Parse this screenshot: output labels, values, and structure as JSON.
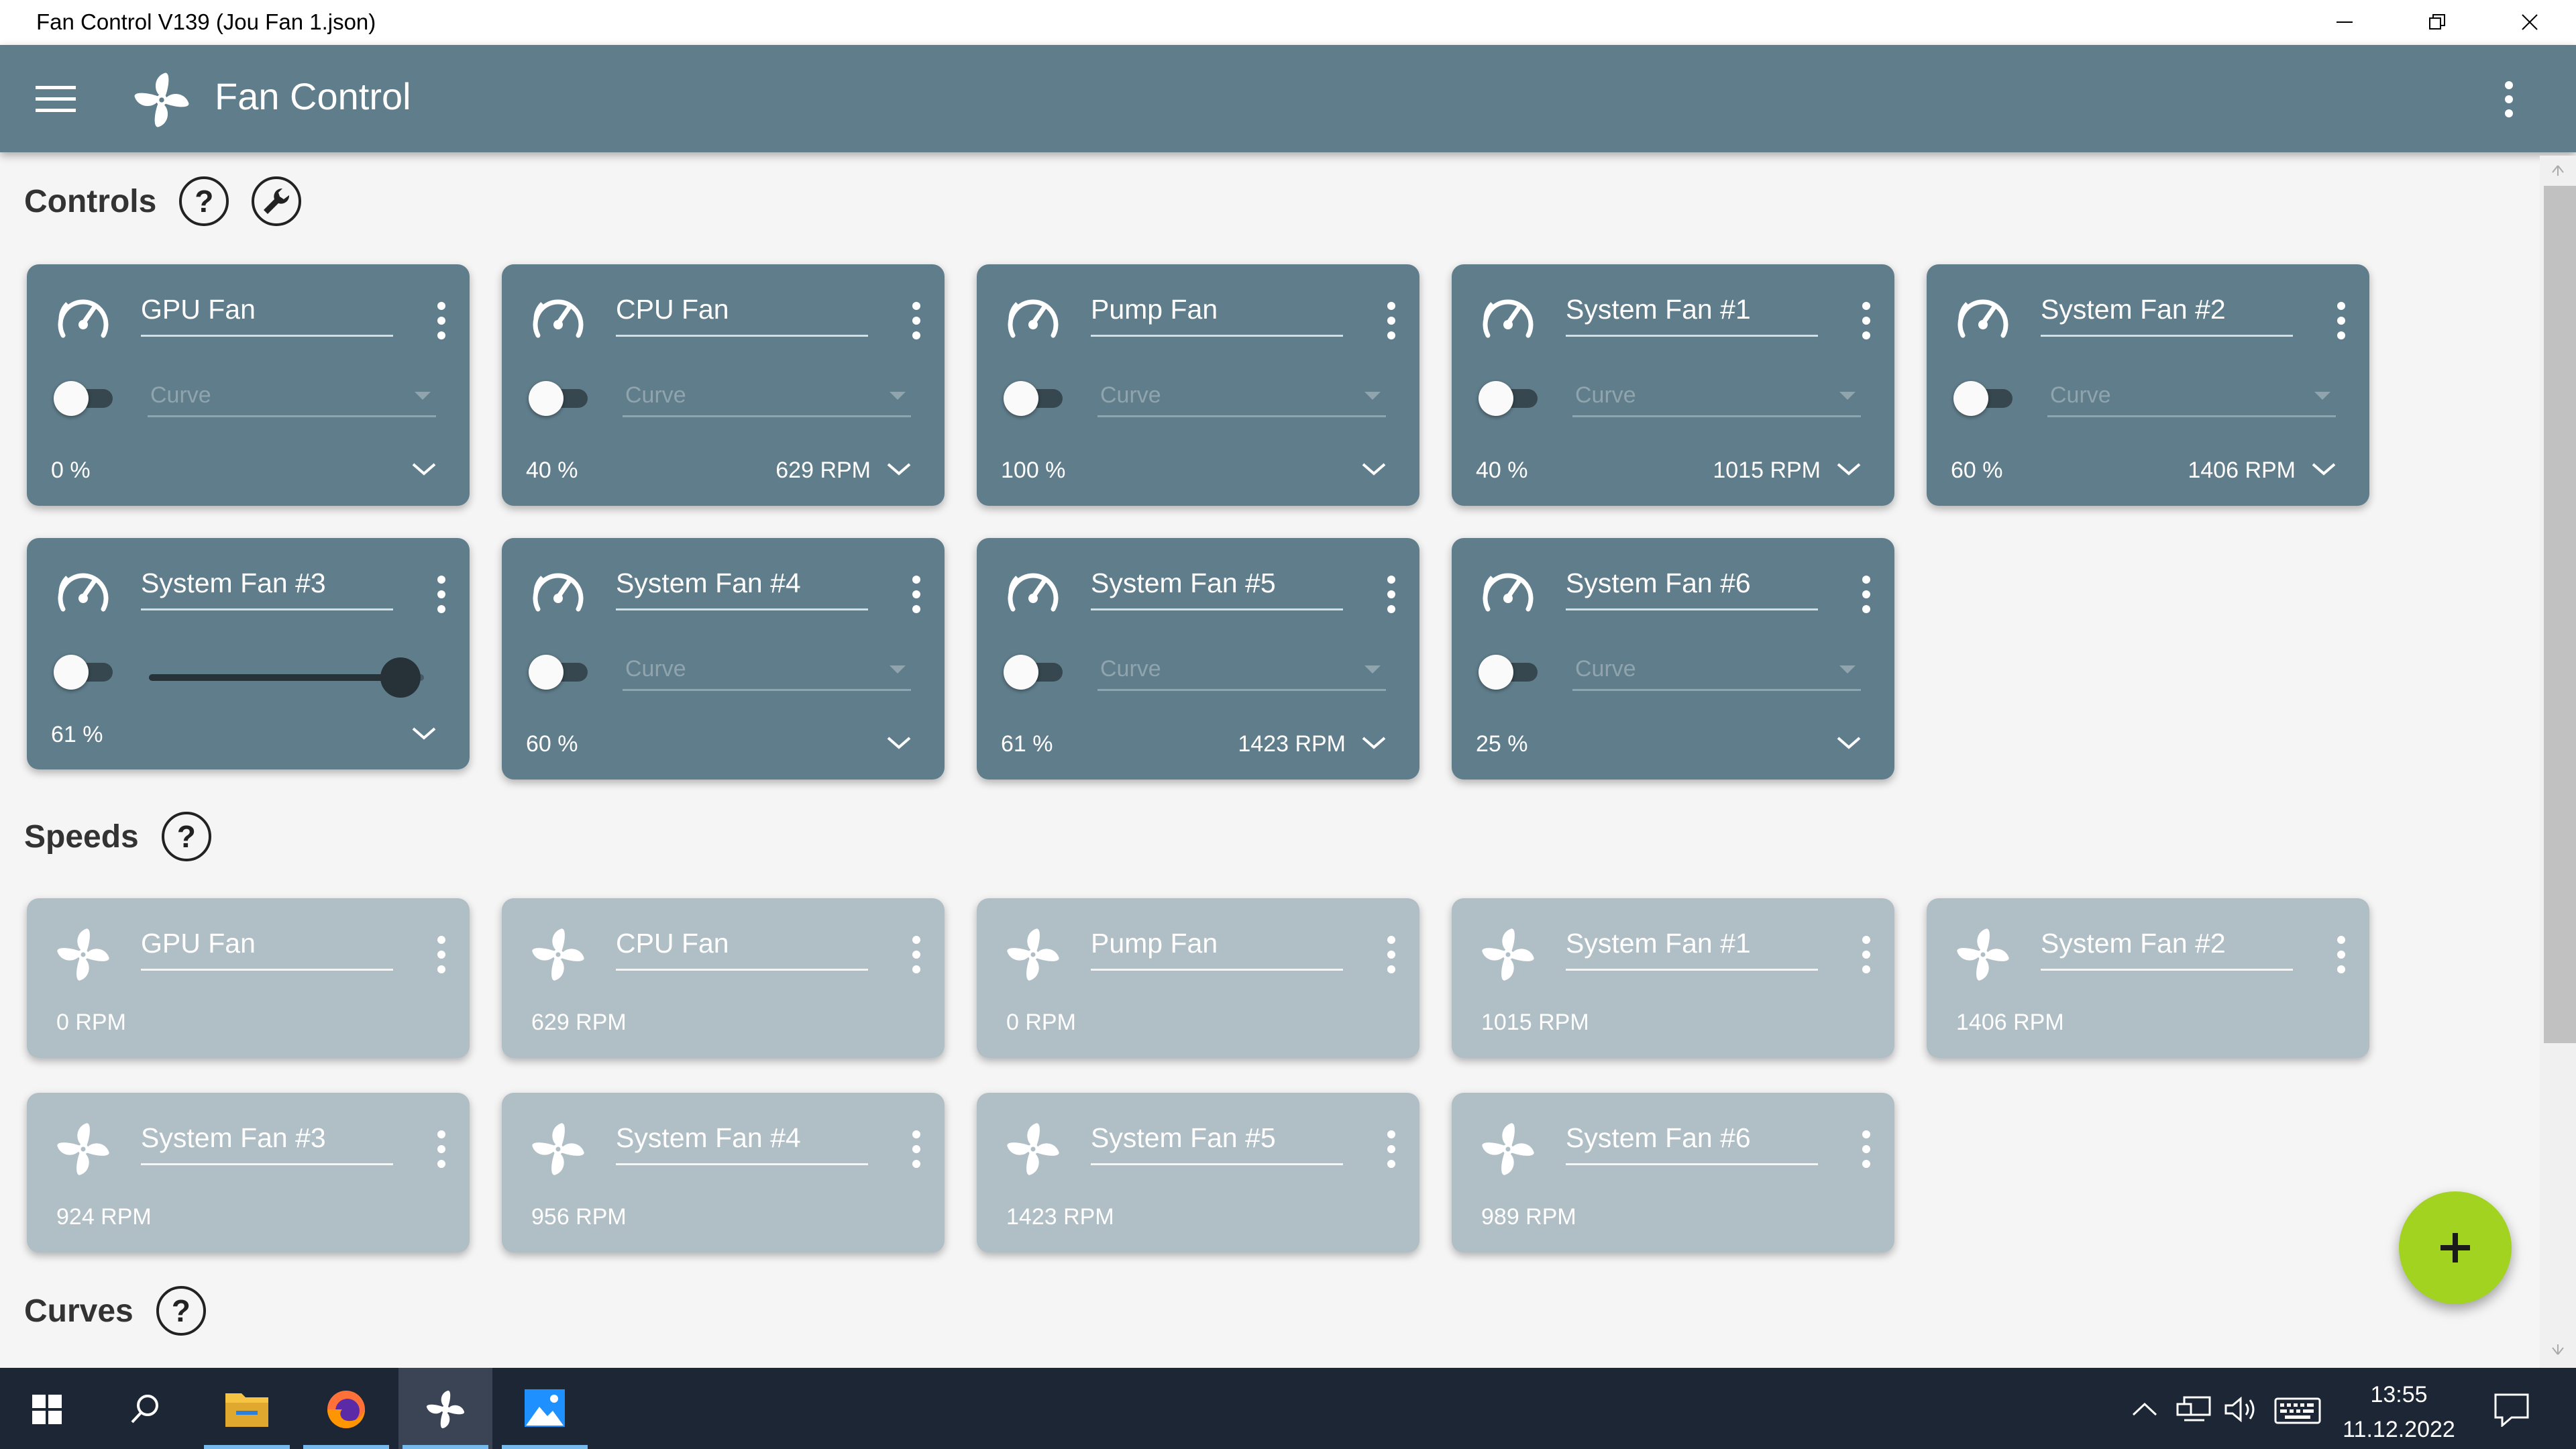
{
  "window": {
    "title": "Fan Control V139 (Jou Fan 1.json)",
    "controls": [
      "minimize-icon",
      "restore-icon",
      "close-icon"
    ]
  },
  "appbar": {
    "title": "Fan Control",
    "menu_icon": "hamburger-menu-icon",
    "logo_icon": "fan-icon",
    "more_icon": "more-vert-icon"
  },
  "sections": {
    "controls": {
      "title": "Controls",
      "help": "?",
      "tool_icon": "wrench-icon"
    },
    "speeds": {
      "title": "Speeds",
      "help": "?"
    },
    "curves": {
      "title": "Curves",
      "help": "?"
    }
  },
  "controls": [
    {
      "name": "GPU Fan",
      "mode": "Curve",
      "enabled": false,
      "percent": "0 %",
      "rpm": ""
    },
    {
      "name": "CPU Fan",
      "mode": "Curve",
      "enabled": false,
      "percent": "40 %",
      "rpm": "629 RPM"
    },
    {
      "name": "Pump Fan",
      "mode": "Curve",
      "enabled": false,
      "percent": "100 %",
      "rpm": ""
    },
    {
      "name": "System Fan #1",
      "mode": "Curve",
      "enabled": false,
      "percent": "40 %",
      "rpm": "1015 RPM"
    },
    {
      "name": "System Fan #2",
      "mode": "Curve",
      "enabled": false,
      "percent": "60 %",
      "rpm": "1406 RPM"
    },
    {
      "name": "System Fan #3",
      "mode": "slider",
      "enabled": false,
      "percent": "61 %",
      "rpm": "",
      "slider_value": 0.61
    },
    {
      "name": "System Fan #4",
      "mode": "Curve",
      "enabled": false,
      "percent": "60 %",
      "rpm": ""
    },
    {
      "name": "System Fan #5",
      "mode": "Curve",
      "enabled": false,
      "percent": "61 %",
      "rpm": "1423 RPM"
    },
    {
      "name": "System Fan #6",
      "mode": "Curve",
      "enabled": false,
      "percent": "25 %",
      "rpm": ""
    }
  ],
  "speeds": [
    {
      "name": "GPU Fan",
      "rpm": "0 RPM"
    },
    {
      "name": "CPU Fan",
      "rpm": "629 RPM"
    },
    {
      "name": "Pump Fan",
      "rpm": "0 RPM"
    },
    {
      "name": "System Fan #1",
      "rpm": "1015 RPM"
    },
    {
      "name": "System Fan #2",
      "rpm": "1406 RPM"
    },
    {
      "name": "System Fan #3",
      "rpm": "924 RPM"
    },
    {
      "name": "System Fan #4",
      "rpm": "956 RPM"
    },
    {
      "name": "System Fan #5",
      "rpm": "1423 RPM"
    },
    {
      "name": "System Fan #6",
      "rpm": "989 RPM"
    }
  ],
  "fab": {
    "icon": "plus-icon"
  },
  "colors": {
    "appbar": "#607d8b",
    "control_card": "#607d8b",
    "speed_card": "#b0bec5",
    "fab": "#a2d320",
    "taskbar": "#1c2634"
  },
  "taskbar": {
    "apps": [
      "windows-start-icon",
      "search-icon",
      "file-explorer-icon",
      "firefox-icon",
      "fan-control-icon",
      "photos-icon"
    ],
    "active_app": "fan-control-icon",
    "tray": [
      "chevron-up-icon",
      "network-icon",
      "volume-icon",
      "keyboard-icon"
    ],
    "time": "13:55",
    "date": "11.12.2022",
    "notification_icon": "notification-icon"
  }
}
